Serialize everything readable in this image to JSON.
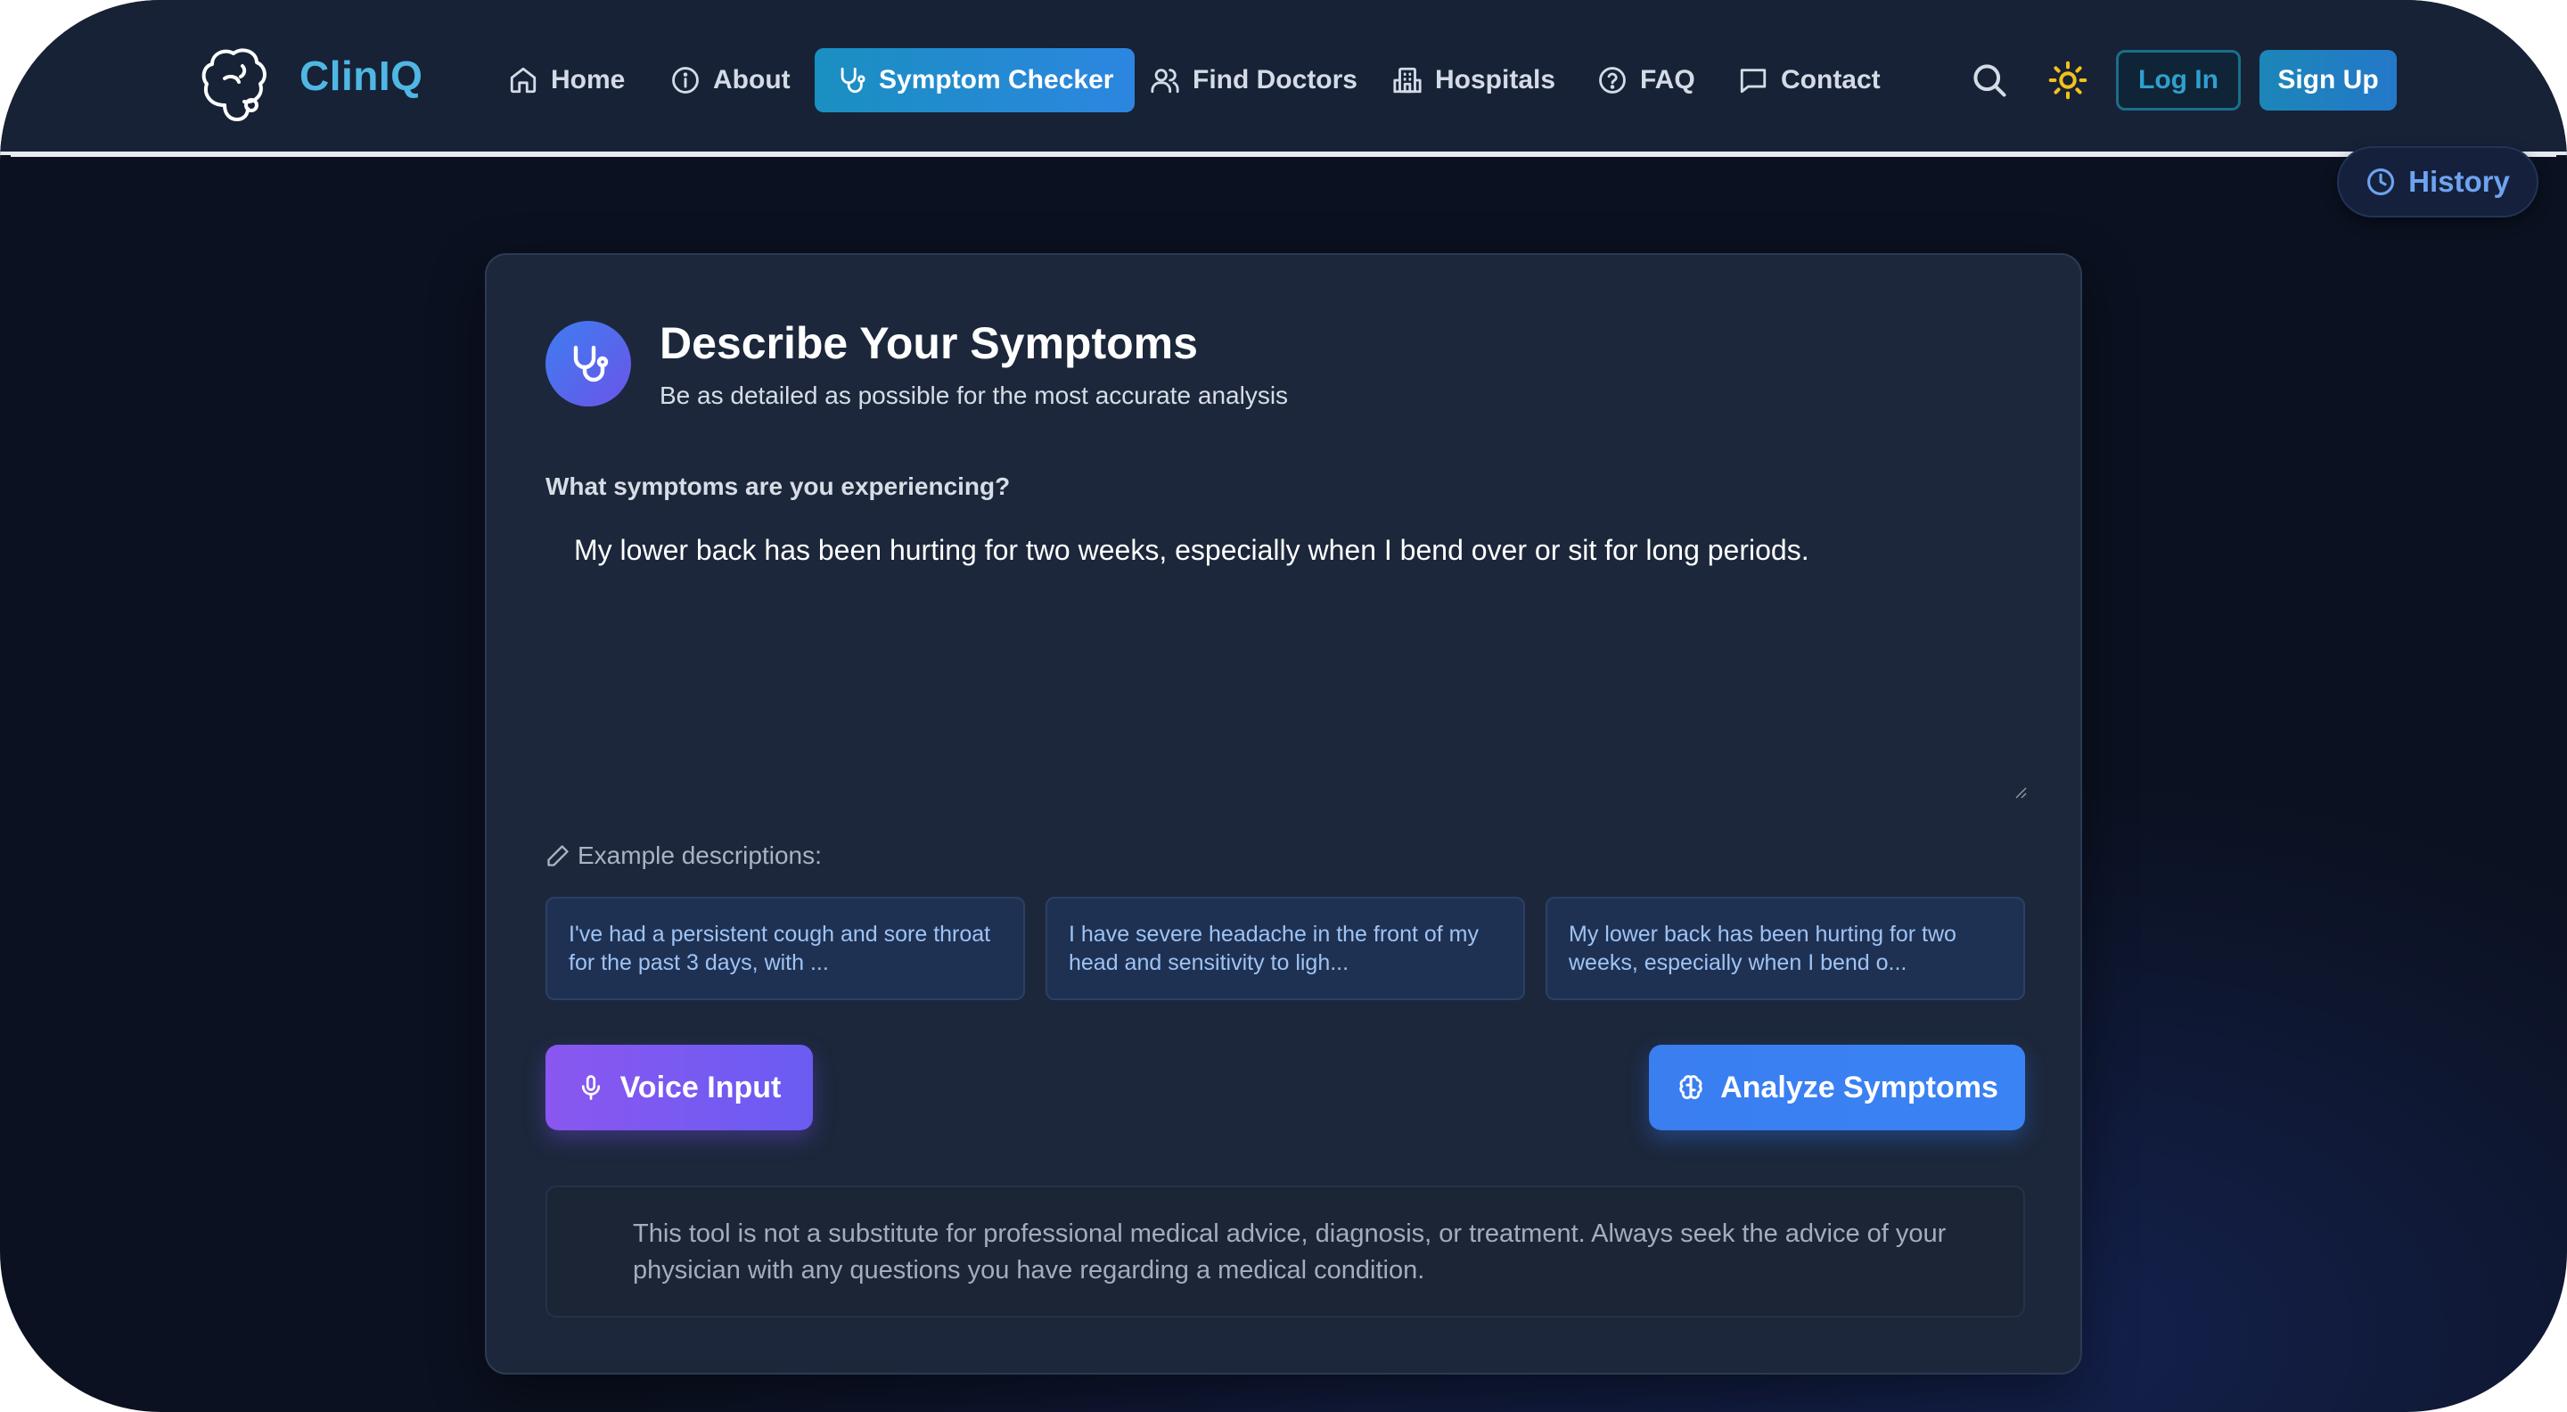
{
  "app": {
    "name": "ClinIQ"
  },
  "nav": {
    "items": [
      {
        "label": "Home",
        "icon": "home-icon"
      },
      {
        "label": "About",
        "icon": "info-icon"
      },
      {
        "label": "Symptom Checker",
        "icon": "stethoscope-icon",
        "active": true
      },
      {
        "label": "Find Doctors",
        "icon": "users-icon"
      },
      {
        "label": "Hospitals",
        "icon": "building-icon"
      },
      {
        "label": "FAQ",
        "icon": "help-circle-icon"
      },
      {
        "label": "Contact",
        "icon": "message-icon"
      }
    ],
    "search_icon": "search-icon",
    "theme_icon": "sun-icon",
    "login_label": "Log In",
    "signup_label": "Sign Up"
  },
  "history": {
    "label": "History",
    "icon": "clock-icon"
  },
  "card": {
    "title": "Describe Your Symptoms",
    "subtitle": "Be as detailed as possible for the most accurate analysis",
    "field_label": "What symptoms are you experiencing?",
    "symptoms_value": "My lower back has been hurting for two weeks, especially when I bend over or sit for long periods.",
    "examples_label": "Example descriptions:",
    "examples": [
      "I've had a persistent cough and sore throat for the past 3 days, with ...",
      "I have severe headache in the front of my head and sensitivity to ligh...",
      "My lower back has been hurting for two weeks, especially when I bend o..."
    ],
    "voice_label": "Voice Input",
    "analyze_label": "Analyze Symptoms",
    "disclaimer": "This tool is not a substitute for professional medical advice, diagnosis, or treatment. Always seek the advice of your physician with any questions you have regarding a medical condition."
  },
  "colors": {
    "accent": "#1a8fc1",
    "brand": "#4fb7e4",
    "background": "#0b1120",
    "card": "#1c273b",
    "voice": "#8a57f0",
    "analyze": "#3a7ef0"
  }
}
